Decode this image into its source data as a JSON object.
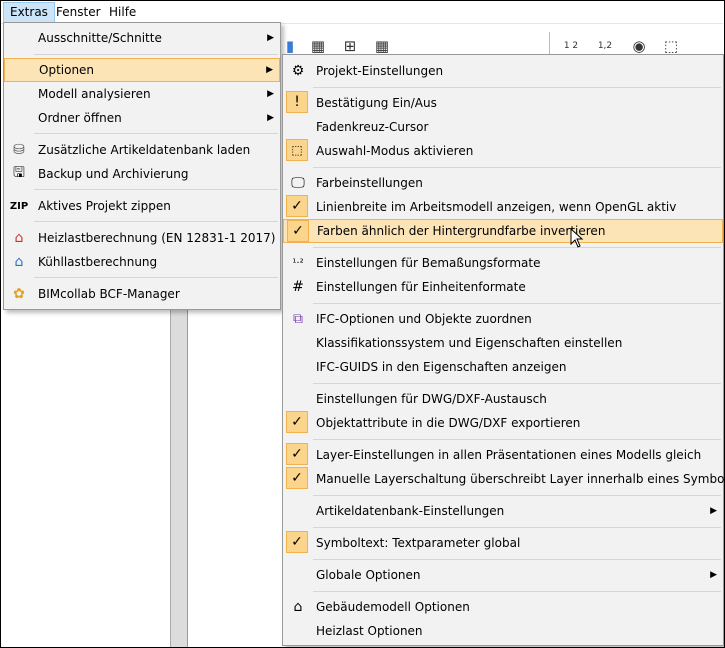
{
  "menubar": {
    "items": [
      {
        "label": "Extras"
      },
      {
        "label": "Fenster"
      },
      {
        "label": "Hilfe"
      }
    ]
  },
  "extras_menu": {
    "items": [
      {
        "label": "Ausschnitte/Schnitte"
      },
      {
        "label": "Optionen"
      },
      {
        "label": "Modell analysieren"
      },
      {
        "label": "Ordner öffnen"
      },
      {
        "label": "Zusätzliche Artikeldatenbank laden"
      },
      {
        "label": "Backup und Archivierung"
      },
      {
        "label": "Aktives Projekt zippen"
      },
      {
        "label": "Heizlastberechnung (EN 12831-1 2017)"
      },
      {
        "label": "Kühllastberechnung"
      },
      {
        "label": "BIMcollab BCF-Manager"
      }
    ]
  },
  "options_menu": {
    "items": [
      {
        "label": "Projekt-Einstellungen"
      },
      {
        "label": "Bestätigung Ein/Aus"
      },
      {
        "label": "Fadenkreuz-Cursor"
      },
      {
        "label": "Auswahl-Modus aktivieren"
      },
      {
        "label": "Farbeinstellungen"
      },
      {
        "label": "Linienbreite im Arbeitsmodell anzeigen, wenn OpenGL aktiv"
      },
      {
        "label": "Farben ähnlich der Hintergrundfarbe invertieren"
      },
      {
        "label": "Einstellungen für Bemaßungsformate"
      },
      {
        "label": "Einstellungen für Einheitenformate"
      },
      {
        "label": "IFC-Optionen und Objekte zuordnen"
      },
      {
        "label": "Klassifikationssystem und Eigenschaften einstellen"
      },
      {
        "label": "IFC-GUIDS in den Eigenschaften anzeigen"
      },
      {
        "label": "Einstellungen für DWG/DXF-Austausch"
      },
      {
        "label": "Objektattribute in die DWG/DXF exportieren"
      },
      {
        "label": "Layer-Einstellungen in allen Präsentationen eines Modells gleich"
      },
      {
        "label": "Manuelle Layerschaltung überschreibt Layer innerhalb eines Symbols"
      },
      {
        "label": "Artikeldatenbank-Einstellungen"
      },
      {
        "label": "Symboltext: Textparameter global"
      },
      {
        "label": "Globale Optionen"
      },
      {
        "label": "Gebäudemodell Optionen"
      },
      {
        "label": "Heizlast Optionen"
      }
    ]
  },
  "toolbar": {
    "dim_label_a": "1 2",
    "dim_label_b": "1,2"
  },
  "colors": {
    "highlight_bg": "#fce4b6",
    "highlight_border": "#f5b14e",
    "check_bg": "#fcd58d",
    "menubar_active": "#cce4f7"
  }
}
